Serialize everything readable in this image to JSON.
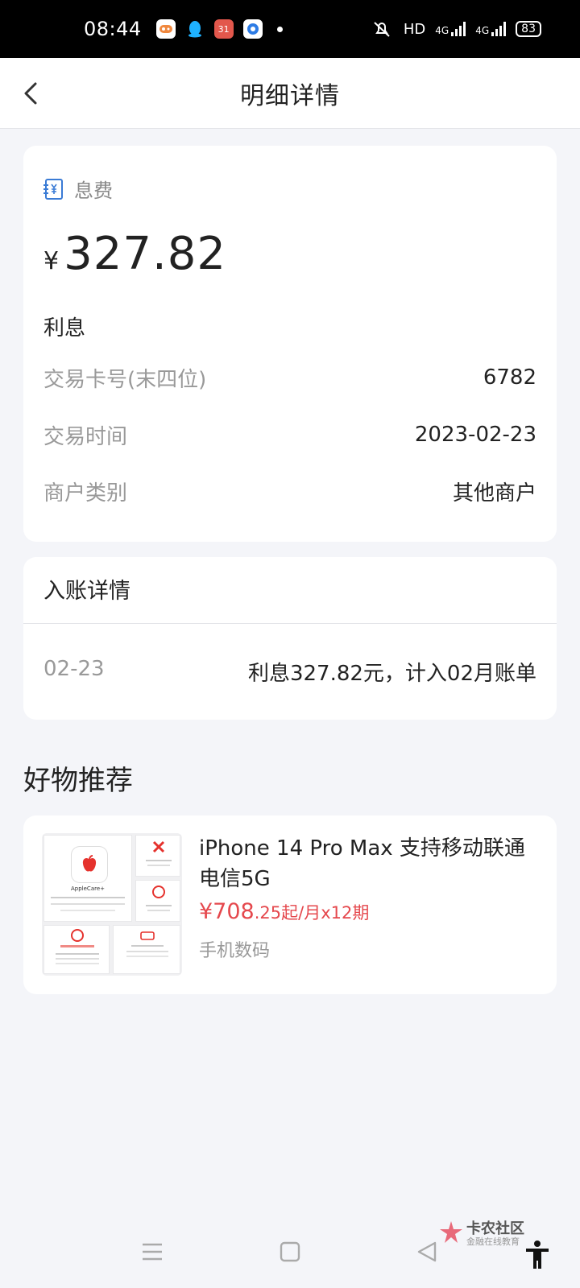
{
  "status_bar": {
    "time": "08:44",
    "hd": "HD",
    "network1": "4G",
    "network2": "4G",
    "battery": "83",
    "notification_badge": "31"
  },
  "navbar": {
    "title": "明细详情"
  },
  "detail": {
    "fee_type": "息费",
    "currency_symbol": "¥",
    "amount": "327.82",
    "description": "利息",
    "rows": [
      {
        "label": "交易卡号(末四位)",
        "value": "6782"
      },
      {
        "label": "交易时间",
        "value": "2023-02-23"
      },
      {
        "label": "商户类别",
        "value": "其他商户"
      }
    ]
  },
  "posting": {
    "header": "入账详情",
    "date": "02-23",
    "text": "利息327.82元，计入02月账单"
  },
  "recommend": {
    "section_title": "好物推荐",
    "product": {
      "title": "iPhone 14 Pro Max 支持移动联通电信5G",
      "price_main": "¥708",
      "price_rest": ".25起/月x12期",
      "category": "手机数码",
      "image_brand_text": "AppleCare+"
    }
  },
  "watermark": {
    "name": "卡农社区",
    "sub": "金融在线教育"
  },
  "colors": {
    "price": "#e5484d",
    "icon_blue": "#3a7bd5",
    "background": "#f4f5f9"
  }
}
